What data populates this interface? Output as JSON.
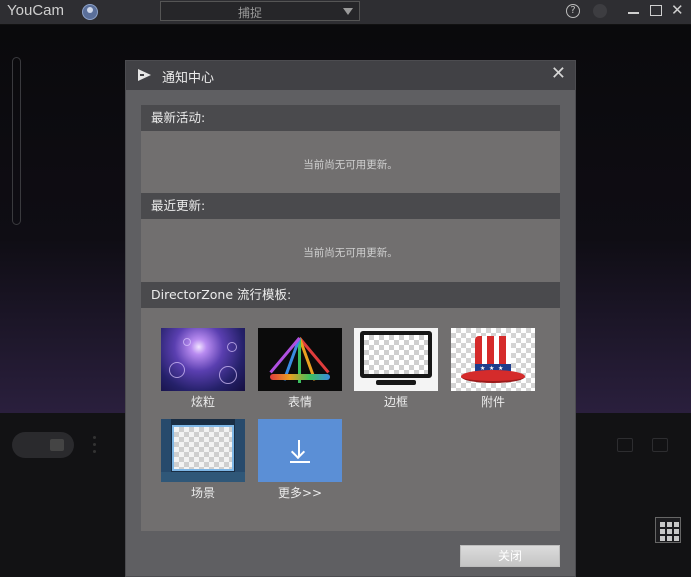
{
  "app": {
    "title": "YouCam"
  },
  "toolbar": {
    "mode_selected": "捕捉"
  },
  "dialog": {
    "title": "通知中心",
    "sections": {
      "latest_activity": {
        "heading": "最新活动:",
        "message": "当前尚无可用更新。"
      },
      "recent_updates": {
        "heading": "最近更新:",
        "message": "当前尚无可用更新。"
      },
      "directorzone": {
        "heading": "DirectorZone 流行模板:",
        "templates": [
          {
            "label": "炫粒",
            "icon": "particles-thumbnail"
          },
          {
            "label": "表情",
            "icon": "emoji-thumbnail"
          },
          {
            "label": "边框",
            "icon": "frame-thumbnail"
          },
          {
            "label": "附件",
            "icon": "accessory-hat-thumbnail"
          },
          {
            "label": "场景",
            "icon": "scene-thumbnail"
          },
          {
            "label": "更多>>",
            "icon": "download-icon"
          }
        ]
      }
    },
    "close_button": "关闭"
  },
  "colors": {
    "dialog_bg": "#5f5f62",
    "dialog_header": "#414145",
    "section_header": "#4a4a4d",
    "more_tile": "#5b8fd6"
  }
}
